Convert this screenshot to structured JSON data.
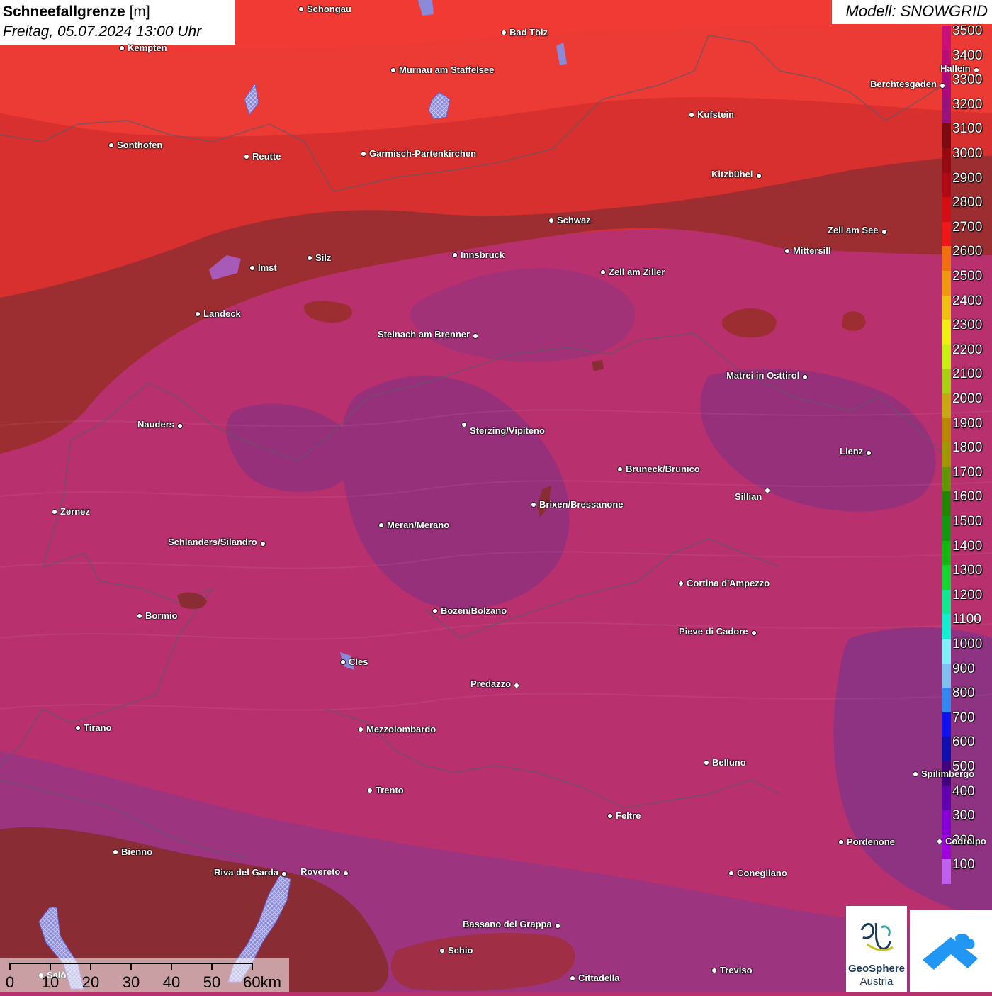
{
  "title": {
    "main": "Schneefallgrenze",
    "unit": "[m]",
    "subtitle": "Freitag, 05.07.2024 13:00 Uhr"
  },
  "model": "Modell: SNOWGRID",
  "legend": {
    "labels": [
      "3500",
      "3400",
      "3300",
      "3200",
      "3100",
      "3000",
      "2900",
      "2800",
      "2700",
      "2600",
      "2500",
      "2400",
      "2300",
      "2200",
      "2100",
      "2000",
      "1900",
      "1800",
      "1700",
      "1600",
      "1500",
      "1400",
      "1300",
      "1200",
      "1100",
      "1000",
      "900",
      "800",
      "700",
      "600",
      "500",
      "400",
      "300",
      "200",
      "100"
    ],
    "colors": [
      "#c8107a",
      "#b80e78",
      "#a80c7c",
      "#96127e",
      "#7a0a14",
      "#960a14",
      "#b00a14",
      "#d40e14",
      "#f01818",
      "#f07010",
      "#f09810",
      "#f0c010",
      "#f0f010",
      "#c8f010",
      "#a8d010",
      "#c8a810",
      "#b88800",
      "#a09800",
      "#609800",
      "#208800",
      "#109810",
      "#10b810",
      "#10d830",
      "#10e890",
      "#10f0d0",
      "#80f0f8",
      "#80c0f0",
      "#3088f0",
      "#1010f0",
      "#1010b0",
      "#400080",
      "#6000b0",
      "#8800d8",
      "#a000e0",
      "#c060f0"
    ]
  },
  "cities": [
    {
      "name": "Schongau"
    },
    {
      "name": "Bad Tölz"
    },
    {
      "name": "Kempten"
    },
    {
      "name": "Murnau am Staffelsee"
    },
    {
      "name": "Hallein"
    },
    {
      "name": "Berchtesgaden"
    },
    {
      "name": "Kufstein"
    },
    {
      "name": "Sonthofen"
    },
    {
      "name": "Reutte"
    },
    {
      "name": "Garmisch-Partenkirchen"
    },
    {
      "name": "Kitzbühel"
    },
    {
      "name": "Schwaz"
    },
    {
      "name": "Zell am See"
    },
    {
      "name": "Silz"
    },
    {
      "name": "Imst"
    },
    {
      "name": "Innsbruck"
    },
    {
      "name": "Mittersill"
    },
    {
      "name": "Zell am Ziller"
    },
    {
      "name": "Landeck"
    },
    {
      "name": "Steinach am Brenner"
    },
    {
      "name": "Matrei in Osttirol"
    },
    {
      "name": "Nauders"
    },
    {
      "name": "Sterzing/Vipiteno"
    },
    {
      "name": "Lienz"
    },
    {
      "name": "Bruneck/Brunico"
    },
    {
      "name": "Sillian"
    },
    {
      "name": "Brixen/Bressanone"
    },
    {
      "name": "Zernez"
    },
    {
      "name": "Meran/Merano"
    },
    {
      "name": "Schlanders/Silandro"
    },
    {
      "name": "Cortina d'Ampezzo"
    },
    {
      "name": "Bozen/Bolzano"
    },
    {
      "name": "Bormio"
    },
    {
      "name": "Pieve di Cadore"
    },
    {
      "name": "Cles"
    },
    {
      "name": "Predazzo"
    },
    {
      "name": "Tirano"
    },
    {
      "name": "Mezzolombardo"
    },
    {
      "name": "Belluno"
    },
    {
      "name": "Spilimbergo"
    },
    {
      "name": "Trento"
    },
    {
      "name": "Feltre"
    },
    {
      "name": "Pordenone"
    },
    {
      "name": "Codroipo"
    },
    {
      "name": "Bienno"
    },
    {
      "name": "Riva del Garda"
    },
    {
      "name": "Rovereto"
    },
    {
      "name": "Conegliano"
    },
    {
      "name": "Bassano del Grappa"
    },
    {
      "name": "Schio"
    },
    {
      "name": "Treviso"
    },
    {
      "name": "Cittadella"
    },
    {
      "name": "Salò"
    }
  ],
  "scale": {
    "labels": [
      "0",
      "10",
      "20",
      "30",
      "40",
      "50",
      "60km"
    ]
  },
  "logos": {
    "geosphere_line1": "GeoSphere",
    "geosphere_line2": "Austria"
  }
}
